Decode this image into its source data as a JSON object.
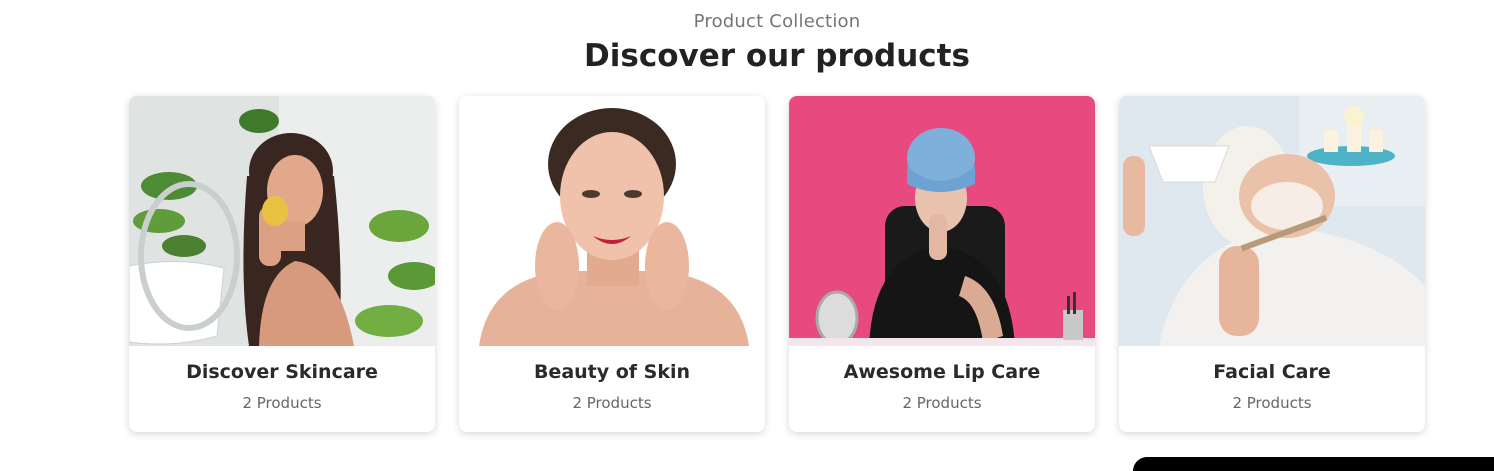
{
  "header": {
    "eyebrow": "Product Collection",
    "title": "Discover our products"
  },
  "collections": [
    {
      "title": "Discover Skincare",
      "count": "2 Products",
      "image": "woman-with-sponge-photo"
    },
    {
      "title": "Beauty of Skin",
      "count": "2 Products",
      "image": "smiling-woman-portrait-photo"
    },
    {
      "title": "Awesome Lip Care",
      "count": "2 Products",
      "image": "woman-with-towel-lip-care-photo"
    },
    {
      "title": "Facial Care",
      "count": "2 Products",
      "image": "facial-mask-treatment-photo"
    }
  ],
  "colors": {
    "card_bg": "#ffffff",
    "lip_care_bg": "#e84a7f",
    "title": "#222222",
    "subtitle": "#757575"
  }
}
